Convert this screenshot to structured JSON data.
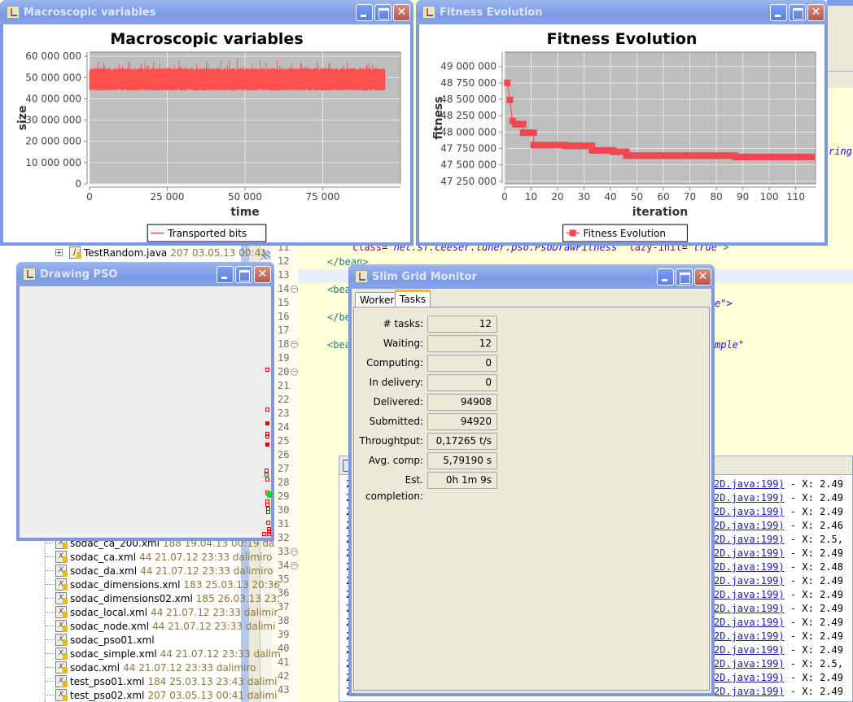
{
  "tree": {
    "top_item": {
      "name": "TestRandom.java",
      "meta": "207  03.05.13 00:41"
    },
    "items": [
      {
        "name": "sodac_ca_200.xml",
        "meta": "188  19.04.13 00:19  da"
      },
      {
        "name": "sodac_ca.xml",
        "meta": "44  21.07.12 23:33  dalimiro"
      },
      {
        "name": "sodac_da.xml",
        "meta": "44  21.07.12 23:33  dalimiro"
      },
      {
        "name": "sodac_dimensions.xml",
        "meta": "183  25.03.13 20:36"
      },
      {
        "name": "sodac_dimensions02.xml",
        "meta": "185  26.03.13 23:"
      },
      {
        "name": "sodac_local.xml",
        "meta": "44  21.07.12 23:33  dalimir"
      },
      {
        "name": "sodac_node.xml",
        "meta": "44  21.07.12 23:33  dalimi"
      },
      {
        "name": "sodac_pso01.xml",
        "meta": ""
      },
      {
        "name": "sodac_simple.xml",
        "meta": "44  21.07.12 23:33  dalim"
      },
      {
        "name": "sodac.xml",
        "meta": "44  21.07.12 23:33  dalimiro"
      },
      {
        "name": "test_pso01.xml",
        "meta": "184  25.03.13 23:43  dalimi"
      },
      {
        "name": "test_pso02.xml",
        "meta": "207  03.05.13 00:41  dalimi"
      }
    ]
  },
  "editor": {
    "line_numbers": [
      "11",
      "12",
      "13",
      "14",
      "15",
      "16",
      "17",
      "18",
      "19",
      "20",
      "21",
      "22",
      "23",
      "24",
      "25",
      "26",
      "27",
      "28",
      "29",
      "30",
      "31",
      "32",
      "33",
      "34",
      "35",
      "36",
      "37",
      "38",
      "39",
      "40",
      "41",
      "42",
      "43"
    ],
    "fold_lines": [
      "14",
      "18",
      "20",
      "33",
      "34"
    ],
    "line11_attr": "class=",
    "line11_value": "\"net.sf.ceeser.tuner.pso.PsoDrawFitness\"",
    "line11_attr2": " lazy-init=",
    "line11_value2": "\"true\"",
    "line11_end": ">",
    "line12": "</bean>",
    "line14": "<bea",
    "line14_tail": "e\">",
    "line16": "</be",
    "line18": "<bea",
    "line18_tail": "mple\"",
    "line_ring": "ring"
  },
  "console": {
    "lines": [
      {
        "prefix": "2",
        "link": "2D.java:199)",
        "text": " - X: 2.49"
      },
      {
        "prefix": "2",
        "link": "2D.java:199)",
        "text": " - X: 2.49"
      },
      {
        "prefix": "2",
        "link": "2D.java:199)",
        "text": " - X: 2.49"
      },
      {
        "prefix": "2",
        "link": "2D.java:199)",
        "text": " - X: 2.46"
      },
      {
        "prefix": "2",
        "link": "2D.java:199)",
        "text": " - X: 2.5,"
      },
      {
        "prefix": "2",
        "link": "2D.java:199)",
        "text": " - X: 2.49"
      },
      {
        "prefix": "2",
        "link": "2D.java:199)",
        "text": " - X: 2.48"
      },
      {
        "prefix": "2",
        "link": "2D.java:199)",
        "text": " - X: 2.49"
      },
      {
        "prefix": "2",
        "link": "2D.java:199)",
        "text": " - X: 2.49"
      },
      {
        "prefix": "2",
        "link": "2D.java:199)",
        "text": " - X: 2.49"
      },
      {
        "prefix": "2",
        "link": "2D.java:199)",
        "text": " - X: 2.49"
      },
      {
        "prefix": "2",
        "link": "2D.java:199)",
        "text": " - X: 2.49"
      },
      {
        "prefix": "2",
        "link": "2D.java:199)",
        "text": " - X: 2.49"
      },
      {
        "prefix": "2",
        "link": "2D.java:199)",
        "text": " - X: 2.5,"
      },
      {
        "prefix": "2",
        "link": "2D.java:199)",
        "text": " - X: 2.49"
      },
      {
        "prefix": "2",
        "link": "2D.java:199)",
        "text": " - X: 2.49"
      }
    ]
  },
  "windows": {
    "macro": {
      "title": "Macroscopic variables"
    },
    "fitness": {
      "title": "Fitness Evolution"
    },
    "pso": {
      "title": "Drawing PSO"
    },
    "grid": {
      "title": "Slim Grid Monitor",
      "tabs": [
        {
          "label": "Workers",
          "selected": false
        },
        {
          "label": "Tasks",
          "selected": true
        }
      ],
      "fields": [
        {
          "label": "# tasks:",
          "value": "12"
        },
        {
          "label": "Waiting:",
          "value": "12"
        },
        {
          "label": "Computing:",
          "value": "0"
        },
        {
          "label": "In delivery:",
          "value": "0"
        },
        {
          "label": "Delivered:",
          "value": "94908"
        },
        {
          "label": "Submitted:",
          "value": "94920"
        },
        {
          "label": "Throughtput:",
          "value": "0,17265 t/s"
        },
        {
          "label": "Avg. comp:",
          "value": "5,79190 s"
        },
        {
          "label": "Est. completion:",
          "value": "0h 1m 9s"
        }
      ]
    }
  },
  "pso_particles": {
    "color": "#e00000",
    "best_color": "#22cc22",
    "note_units": "screen-relative positions not printed",
    "points": [
      {
        "x": 0.985,
        "y": 0.33
      },
      {
        "x": 0.985,
        "y": 0.49
      },
      {
        "x": 0.985,
        "y": 0.545,
        "filled": true
      },
      {
        "x": 0.985,
        "y": 0.585
      },
      {
        "x": 0.985,
        "y": 0.597
      },
      {
        "x": 0.985,
        "y": 0.627,
        "filled": true
      },
      {
        "x": 0.98,
        "y": 0.73
      },
      {
        "x": 0.98,
        "y": 0.748
      },
      {
        "x": 0.985,
        "y": 0.768
      },
      {
        "x": 0.985,
        "y": 0.82
      },
      {
        "x": 0.985,
        "y": 0.855
      },
      {
        "x": 0.985,
        "y": 0.868
      },
      {
        "x": 0.988,
        "y": 0.884
      },
      {
        "x": 0.988,
        "y": 0.898
      },
      {
        "x": 0.988,
        "y": 0.94
      },
      {
        "x": 0.99,
        "y": 0.963
      },
      {
        "x": 0.99,
        "y": 0.975
      },
      {
        "x": 0.97,
        "y": 0.985
      },
      {
        "x": 0.99,
        "y": 0.985
      }
    ]
  },
  "chart_data": [
    {
      "type": "line",
      "title": "Macroscopic variables",
      "xlabel": "time",
      "ylabel": "size",
      "xlim": [
        0,
        100000
      ],
      "ylim": [
        0,
        62000000
      ],
      "xticks": [
        0,
        25000,
        50000,
        75000
      ],
      "xtick_labels": [
        "0",
        "25 000",
        "50 000",
        "75 000"
      ],
      "yticks": [
        0,
        10000000,
        20000000,
        30000000,
        40000000,
        50000000,
        60000000
      ],
      "ytick_labels": [
        "0",
        "10 000 000",
        "20 000 000",
        "30 000 000",
        "40 000 000",
        "50 000 000",
        "60 000 000"
      ],
      "grid": true,
      "legend": "bottom",
      "series": [
        {
          "name": "Transported bits",
          "color": "#ff5050",
          "x_range": [
            0,
            95000
          ],
          "y_mean": 48500000,
          "y_typical_range": [
            45000000,
            53000000
          ],
          "y_min": 44000000,
          "y_max": 59000000
        }
      ]
    },
    {
      "type": "line",
      "title": "Fitness Evolution",
      "xlabel": "iteration",
      "ylabel": "fitness",
      "xlim": [
        0,
        117.5
      ],
      "ylim": [
        47210000,
        49220000
      ],
      "xticks": [
        0,
        10,
        20,
        30,
        40,
        50,
        60,
        70,
        80,
        90,
        100,
        110
      ],
      "xtick_labels": [
        "0",
        "10",
        "20",
        "30",
        "40",
        "50",
        "60",
        "70",
        "80",
        "90",
        "100",
        "110"
      ],
      "yticks": [
        47250000,
        47500000,
        47750000,
        48000000,
        48250000,
        48500000,
        48750000,
        49000000
      ],
      "ytick_labels": [
        "47 250 000",
        "47 500 000",
        "47 750 000",
        "48 000 000",
        "48 250 000",
        "48 500 000",
        "48 750 000",
        "49 000 000"
      ],
      "grid": true,
      "legend": "bottom",
      "series": [
        {
          "name": "Fitness Evolution",
          "color": "#f04850",
          "marker": "square",
          "steps": [
            {
              "from": 1,
              "to": 1,
              "value": 48750000
            },
            {
              "from": 2,
              "to": 2,
              "value": 48490000
            },
            {
              "from": 3,
              "to": 3,
              "value": 48170000
            },
            {
              "from": 4,
              "to": 7,
              "value": 48120000
            },
            {
              "from": 7,
              "to": 11,
              "value": 47990000
            },
            {
              "from": 11,
              "to": 23,
              "value": 47800000
            },
            {
              "from": 23,
              "to": 33,
              "value": 47790000
            },
            {
              "from": 33,
              "to": 41,
              "value": 47720000
            },
            {
              "from": 41,
              "to": 46,
              "value": 47700000
            },
            {
              "from": 46,
              "to": 87,
              "value": 47640000
            },
            {
              "from": 87,
              "to": 116,
              "value": 47620000
            }
          ]
        }
      ]
    }
  ]
}
